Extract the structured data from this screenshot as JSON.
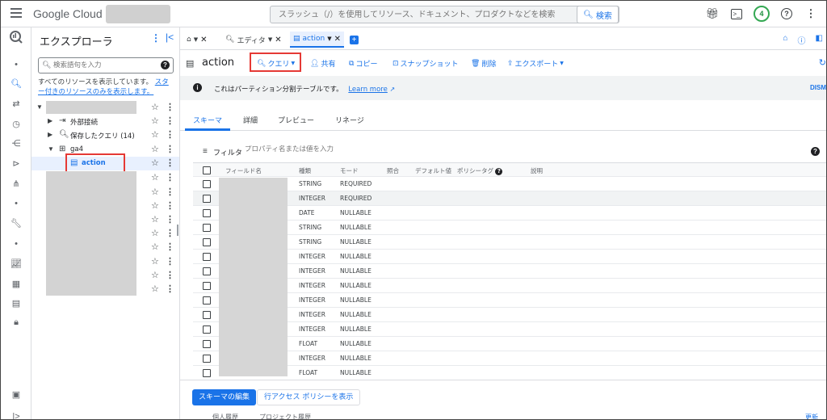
{
  "topbar": {
    "logo_google": "Google",
    "logo_cloud": "Cloud",
    "search_placeholder": "スラッシュ（/）を使用してリソース、ドキュメント、プロダクトなどを検索",
    "search_button": "検索",
    "avatar_badge": "4"
  },
  "explorer": {
    "title": "エクスプローラ",
    "search_placeholder": "検索語句を入力",
    "note_text": "すべてのリソースを表示しています。",
    "note_link": "スター付きのリソースのみを表示します。",
    "external": "外部接続",
    "saved_queries": "保存したクエリ (14)",
    "dataset": "ga4",
    "table": "action"
  },
  "tabs": {
    "editor": "エディタ",
    "action": "action"
  },
  "toolbar": {
    "table_name": "action",
    "query": "クエリ",
    "share": "共有",
    "copy": "コピー",
    "snapshot": "スナップショット",
    "delete": "削除",
    "export": "エクスポート"
  },
  "banner": {
    "text": "これはパーティション分割テーブルです。",
    "link": "Learn more",
    "dismiss": "DISM"
  },
  "subtabs": [
    "スキーマ",
    "詳細",
    "プレビュー",
    "リネージ"
  ],
  "filter": {
    "label": "フィルタ",
    "placeholder": "プロパティ名または値を入力"
  },
  "schema": {
    "headers": [
      "フィールド名",
      "種類",
      "モード",
      "照合",
      "デフォルト値",
      "ポリシータグ",
      "説明"
    ],
    "rows": [
      {
        "type": "STRING",
        "mode": "REQUIRED"
      },
      {
        "type": "INTEGER",
        "mode": "REQUIRED"
      },
      {
        "type": "DATE",
        "mode": "NULLABLE"
      },
      {
        "type": "STRING",
        "mode": "NULLABLE"
      },
      {
        "type": "STRING",
        "mode": "NULLABLE"
      },
      {
        "type": "INTEGER",
        "mode": "NULLABLE"
      },
      {
        "type": "INTEGER",
        "mode": "NULLABLE"
      },
      {
        "type": "INTEGER",
        "mode": "NULLABLE"
      },
      {
        "type": "INTEGER",
        "mode": "NULLABLE"
      },
      {
        "type": "INTEGER",
        "mode": "NULLABLE"
      },
      {
        "type": "INTEGER",
        "mode": "NULLABLE"
      },
      {
        "type": "FLOAT",
        "mode": "NULLABLE"
      },
      {
        "type": "INTEGER",
        "mode": "NULLABLE"
      },
      {
        "type": "FLOAT",
        "mode": "NULLABLE"
      }
    ]
  },
  "footer": {
    "edit_schema": "スキーマの編集",
    "row_access": "行アクセス ポリシーを表示",
    "history_cut": "個人履歴",
    "project_history_cut": "プロジェクト履歴",
    "refresh_cut": "更新"
  },
  "colors": {
    "accent": "#1a73e8",
    "highlight_box": "#e53935",
    "avatar_ring": "#34a853"
  }
}
